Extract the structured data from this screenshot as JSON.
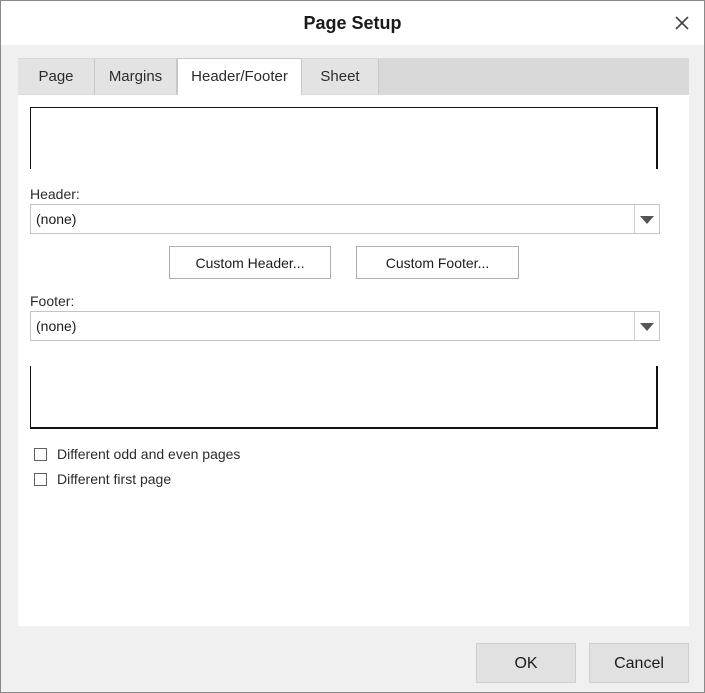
{
  "window": {
    "title": "Page Setup",
    "close_icon": "close-icon"
  },
  "tabs": [
    {
      "label": "Page",
      "active": false
    },
    {
      "label": "Margins",
      "active": false
    },
    {
      "label": "Header/Footer",
      "active": true
    },
    {
      "label": "Sheet",
      "active": false
    }
  ],
  "header": {
    "label": "Header:",
    "value": "(none)"
  },
  "footer": {
    "label": "Footer:",
    "value": "(none)"
  },
  "buttons": {
    "custom_header": "Custom Header...",
    "custom_footer": "Custom Footer...",
    "ok": "OK",
    "cancel": "Cancel"
  },
  "options": {
    "odd_even": {
      "label": "Different odd and even pages",
      "checked": false
    },
    "first_page": {
      "label": "Different first page",
      "checked": false
    }
  },
  "colors": {
    "dialog_background": "#f0f0f0",
    "panel_background": "#ffffff",
    "tabstrip": "#d9d9d9",
    "button_face": "#e1e1e1"
  }
}
